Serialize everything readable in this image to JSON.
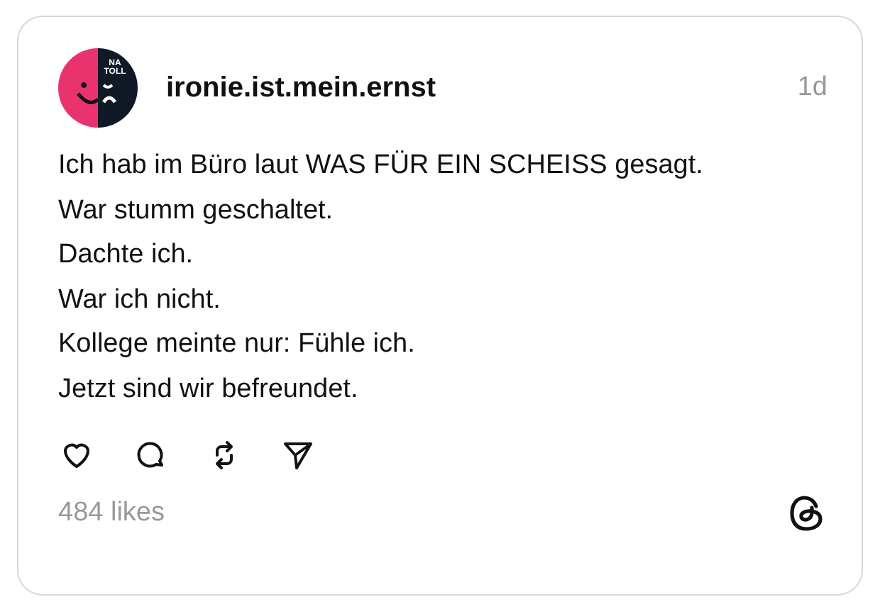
{
  "post": {
    "avatar_text": "NA TOLL",
    "username": "ironie.ist.mein.ernst",
    "time": "1d",
    "lines": [
      "Ich hab im Büro laut WAS FÜR EIN SCHEISS gesagt.",
      "War stumm geschaltet.",
      "Dachte ich.",
      "War ich nicht.",
      "Kollege meinte nur: Fühle ich.",
      "Jetzt sind wir befreundet."
    ],
    "likes": "484 likes"
  }
}
